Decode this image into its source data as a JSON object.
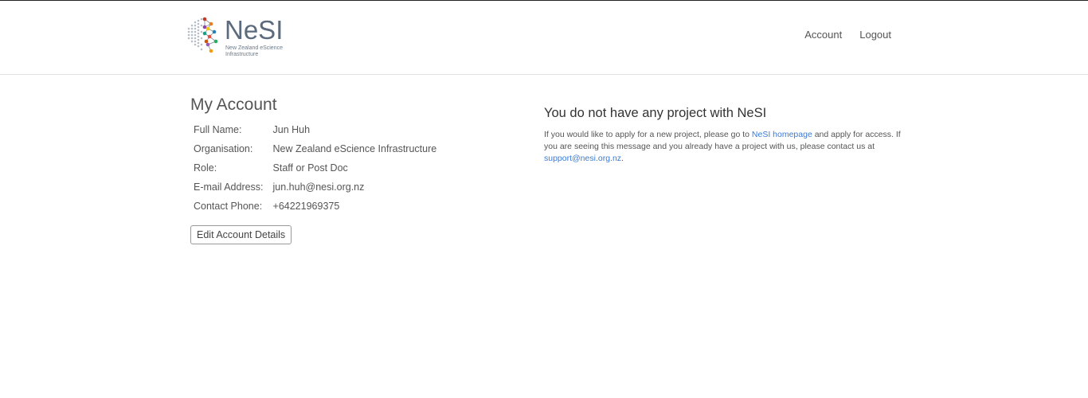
{
  "header": {
    "logo": {
      "wordmark": "NeSI",
      "tagline_line1": "New Zealand eScience",
      "tagline_line2": "Infrastructure"
    },
    "nav": {
      "account": "Account",
      "logout": "Logout"
    }
  },
  "account": {
    "title": "My Account",
    "fields": [
      {
        "label": "Full Name:",
        "value": "Jun Huh"
      },
      {
        "label": "Organisation:",
        "value": "New Zealand eScience Infrastructure"
      },
      {
        "label": "Role:",
        "value": "Staff or Post Doc"
      },
      {
        "label": "E-mail Address:",
        "value": "jun.huh@nesi.org.nz"
      },
      {
        "label": "Contact Phone:",
        "value": "+64221969375"
      }
    ],
    "edit_button": "Edit Account Details"
  },
  "notice": {
    "title": "You do not have any project with NeSI",
    "text_part1": "If you would like to apply for a new project, please go to ",
    "homepage_link": "NeSI homepage",
    "text_part2": " and apply for access. If you are seeing this message and you already have a project with us, please contact us at ",
    "support_link": "support@nesi.org.nz",
    "text_part3": "."
  },
  "colors": {
    "link": "#3a7bd5",
    "text": "#555555",
    "logo_text": "#5b6b7d"
  }
}
